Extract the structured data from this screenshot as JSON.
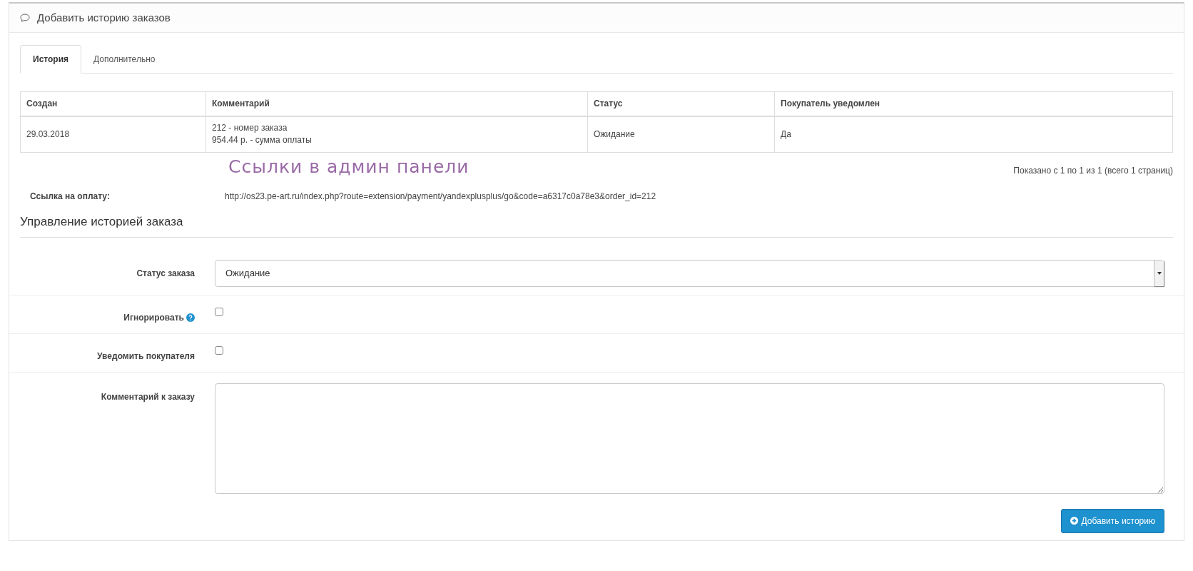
{
  "panel": {
    "title": "Добавить историю заказов"
  },
  "tabs": [
    {
      "label": "История",
      "selected": true
    },
    {
      "label": "Дополнительно",
      "selected": false
    }
  ],
  "table": {
    "columns": [
      "Создан",
      "Комментарий",
      "Статус",
      "Покупатель уведомлен"
    ],
    "rows": [
      {
        "cells": [
          "29.03.2018",
          "212 - номер заказа\n954.44 р. - сумма оплаты",
          "Ожидание",
          "Да"
        ]
      }
    ]
  },
  "annotation": "Ссылки в админ панели",
  "pagination": "Показано с 1 по 1 из 1 (всего 1 страниц)",
  "payment_link": {
    "label": "Ссылка на оплату:",
    "value": "http://os23.pe-art.ru/index.php?route=extension/payment/yandexplusplus/go&code=a6317c0a78e3&order_id=212"
  },
  "section_title": "Управление историей заказа",
  "form": [
    {
      "kind": "select",
      "label": "Статус заказа",
      "value": "Ожидание"
    },
    {
      "kind": "checkbox",
      "label": "Игнорировать",
      "help": true,
      "checked": false
    },
    {
      "kind": "checkbox",
      "label": "Уведомить покупателя",
      "help": false,
      "checked": false
    },
    {
      "kind": "textarea",
      "label": "Комментарий к заказу"
    }
  ],
  "submit_button": "Добавить историю"
}
